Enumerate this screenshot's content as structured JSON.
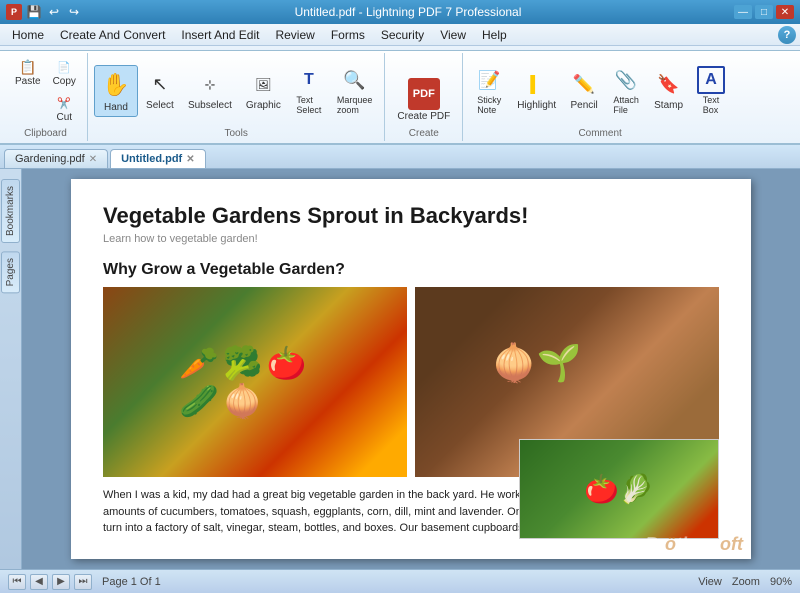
{
  "titleBar": {
    "title": "Untitled.pdf - Lightning PDF 7 Professional",
    "icons": [
      "pdf-icon",
      "save-icon",
      "undo-icon",
      "redo-icon"
    ]
  },
  "menuBar": {
    "items": [
      "Home",
      "Create And Convert",
      "Insert And Edit",
      "Review",
      "Forms",
      "Security",
      "View",
      "Help"
    ]
  },
  "ribbon": {
    "activeTab": "Home",
    "groups": [
      {
        "label": "Clipboard",
        "items": [
          {
            "id": "paste",
            "label": "Paste",
            "icon": "📋"
          },
          {
            "id": "copy",
            "label": "Copy",
            "icon": "📄"
          },
          {
            "id": "cut",
            "label": "Cut",
            "icon": "✂️"
          }
        ]
      },
      {
        "label": "Tools",
        "items": [
          {
            "id": "hand",
            "label": "Hand",
            "icon": "✋",
            "active": true
          },
          {
            "id": "select",
            "label": "Select",
            "icon": "↖"
          },
          {
            "id": "subselect",
            "label": "Subselect",
            "icon": "↗"
          },
          {
            "id": "graphic",
            "label": "Graphic",
            "icon": "🖼"
          },
          {
            "id": "text",
            "label": "Text Select",
            "icon": "T"
          },
          {
            "id": "marquee",
            "label": "Marquee zoom",
            "icon": "🔍"
          }
        ]
      },
      {
        "label": "Create",
        "items": [
          {
            "id": "create-pdf",
            "label": "Create PDF",
            "icon": "📑"
          }
        ]
      },
      {
        "label": "Comment",
        "items": [
          {
            "id": "sticky",
            "label": "Sticky Note",
            "icon": "📝"
          },
          {
            "id": "highlight",
            "label": "Highlight",
            "icon": "🖊"
          },
          {
            "id": "pencil",
            "label": "Pencil",
            "icon": "✏️"
          },
          {
            "id": "attach",
            "label": "Attach File",
            "icon": "📎"
          },
          {
            "id": "stamp",
            "label": "Stamp",
            "icon": "🔖"
          },
          {
            "id": "textbox",
            "label": "Text Box",
            "icon": "A"
          }
        ]
      }
    ]
  },
  "tabs": [
    {
      "label": "Gardening.pdf",
      "active": false
    },
    {
      "label": "Untitled.pdf",
      "active": true
    }
  ],
  "sidebar": {
    "items": [
      "Bookmarks",
      "Pages"
    ]
  },
  "document": {
    "title": "Vegetable Gardens Sprout in Backyards!",
    "subtitle": "Learn how to vegetable garden!",
    "sectionTitle": "Why Grow a Vegetable Garden?",
    "bodyText": "When I was a kid, my dad had a great big vegetable garden in the back yard. He worked it religiously, growing copious amounts of cucumbers, tomatoes, squash, eggplants, corn, dill, mint and lavender. On Sunday's in the Fall our kitchen would turn into a factory of salt, vinegar, steam, bottles, and boxes. Our basement cupboards were full of preserved food"
  },
  "statusBar": {
    "pageInfo": "Page 1 Of 1",
    "view": "View",
    "zoom": "Zoom",
    "zoomLevel": "90%"
  }
}
